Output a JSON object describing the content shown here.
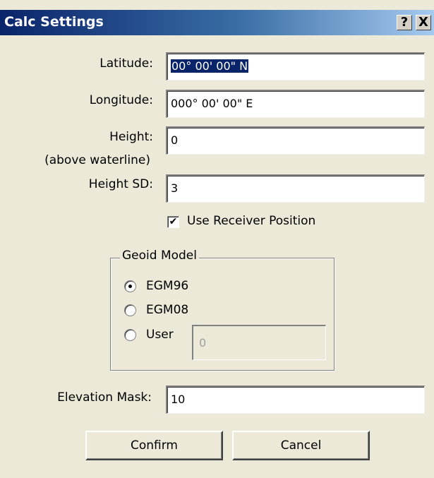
{
  "window": {
    "title": "Calc Settings",
    "help_glyph": "?",
    "close_glyph": "X"
  },
  "fields": {
    "latitude_label": "Latitude:",
    "latitude_value": "00° 00' 00\" N",
    "longitude_label": "Longitude:",
    "longitude_value": "000° 00' 00\" E",
    "height_label": "Height:",
    "height_sublabel": "(above waterline)",
    "height_value": "0",
    "height_sd_label": "Height SD:",
    "height_sd_value": "3",
    "elevation_mask_label": "Elevation Mask:",
    "elevation_mask_value": "10"
  },
  "receiver": {
    "label": "Use Receiver Position",
    "checked": true,
    "check_glyph": "✔"
  },
  "geoid": {
    "title": "Geoid Model",
    "options": [
      {
        "label": "EGM96",
        "selected": true
      },
      {
        "label": "EGM08",
        "selected": false
      },
      {
        "label": "User",
        "selected": false
      }
    ],
    "user_value": "0"
  },
  "buttons": {
    "confirm": "Confirm",
    "cancel": "Cancel"
  }
}
